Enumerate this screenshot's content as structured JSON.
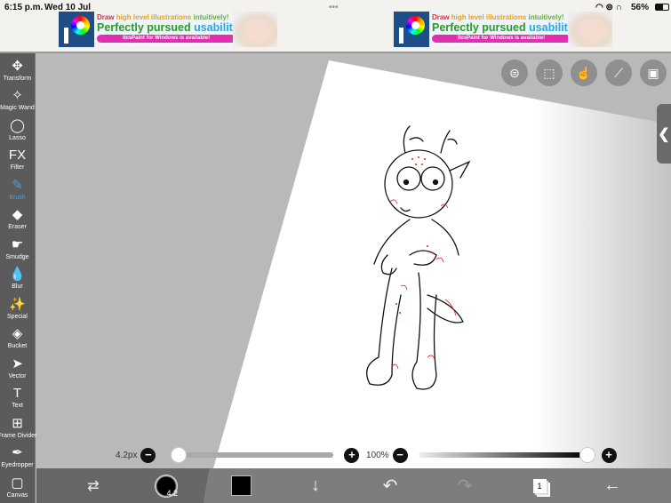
{
  "status": {
    "time": "6:15 p.m.",
    "date": "Wed 10 Jul",
    "battery": "56%"
  },
  "ad": {
    "line1_a": "Draw ",
    "line1_b": "high level illustrations ",
    "line1_c": "intuitively!",
    "line2_a": "Perfectly pursued ",
    "line2_b": "usability!",
    "pill": "ibisPaint for Windows is available!",
    "logo": "iP"
  },
  "tools": [
    {
      "label": "Transform",
      "icon": "✥"
    },
    {
      "label": "Magic Wand",
      "icon": "✧"
    },
    {
      "label": "Lasso",
      "icon": "◯"
    },
    {
      "label": "Filter",
      "icon": "FX"
    },
    {
      "label": "Brush",
      "icon": "✎"
    },
    {
      "label": "Eraser",
      "icon": "◆"
    },
    {
      "label": "Smudge",
      "icon": "☛"
    },
    {
      "label": "Blur",
      "icon": "💧"
    },
    {
      "label": "Special",
      "icon": "✨"
    },
    {
      "label": "Bucket",
      "icon": "◈"
    },
    {
      "label": "Vector",
      "icon": "➤"
    },
    {
      "label": "Text",
      "icon": "T"
    },
    {
      "label": "Frame Divider",
      "icon": "⊞"
    },
    {
      "label": "Eyedropper",
      "icon": "✒"
    },
    {
      "label": "Canvas",
      "icon": "▢"
    }
  ],
  "active_tool": "Brush",
  "brush": {
    "size_label": "4.2px",
    "size_fraction": 0.03,
    "opacity_label": "100%",
    "opacity": 1.0,
    "preview_size": "4.2"
  },
  "colors": {
    "current": "#000000",
    "accent": "#3ea0f0"
  },
  "layers": {
    "count": "1"
  }
}
